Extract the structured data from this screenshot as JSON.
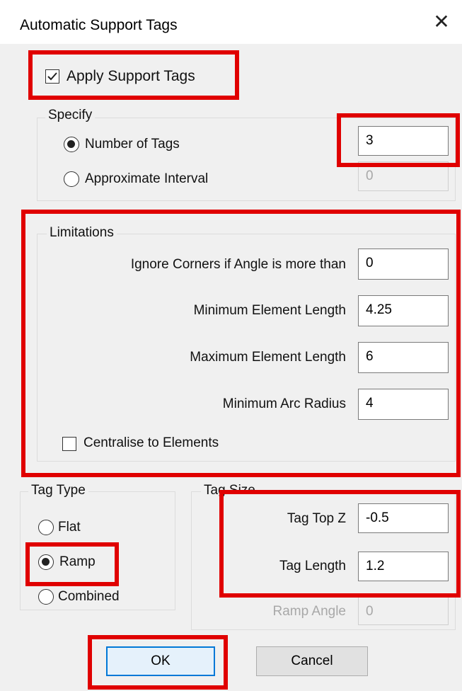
{
  "dialog": {
    "title": "Automatic Support Tags",
    "close_glyph": "✕"
  },
  "apply": {
    "label": "Apply Support Tags",
    "checked": true
  },
  "specify": {
    "group_label": "Specify",
    "number_of_tags": {
      "label": "Number of Tags",
      "selected": true,
      "value": "3"
    },
    "approximate_interval": {
      "label": "Approximate Interval",
      "selected": false,
      "value": "0",
      "disabled": true
    }
  },
  "limitations": {
    "group_label": "Limitations",
    "ignore_corners": {
      "label": "Ignore Corners if Angle is more than",
      "value": "0"
    },
    "min_element_length": {
      "label": "Minimum Element Length",
      "value": "4.25"
    },
    "max_element_length": {
      "label": "Maximum Element Length",
      "value": "6"
    },
    "min_arc_radius": {
      "label": "Minimum Arc Radius",
      "value": "4"
    },
    "centralise": {
      "label": "Centralise to Elements",
      "checked": false
    }
  },
  "tag_type": {
    "group_label": "Tag Type",
    "options": [
      {
        "label": "Flat",
        "selected": false
      },
      {
        "label": "Ramp",
        "selected": true
      },
      {
        "label": "Combined",
        "selected": false
      }
    ]
  },
  "tag_size": {
    "group_label": "Tag Size",
    "tag_top_z": {
      "label": "Tag Top Z",
      "value": "-0.5"
    },
    "tag_length": {
      "label": "Tag Length",
      "value": "1.2"
    },
    "ramp_angle": {
      "label": "Ramp Angle",
      "value": "0",
      "disabled": true
    }
  },
  "buttons": {
    "ok": "OK",
    "cancel": "Cancel"
  },
  "colors": {
    "highlight": "#e00000",
    "default_button_border": "#0078d7",
    "dialog_bg": "#f0f0f0"
  }
}
